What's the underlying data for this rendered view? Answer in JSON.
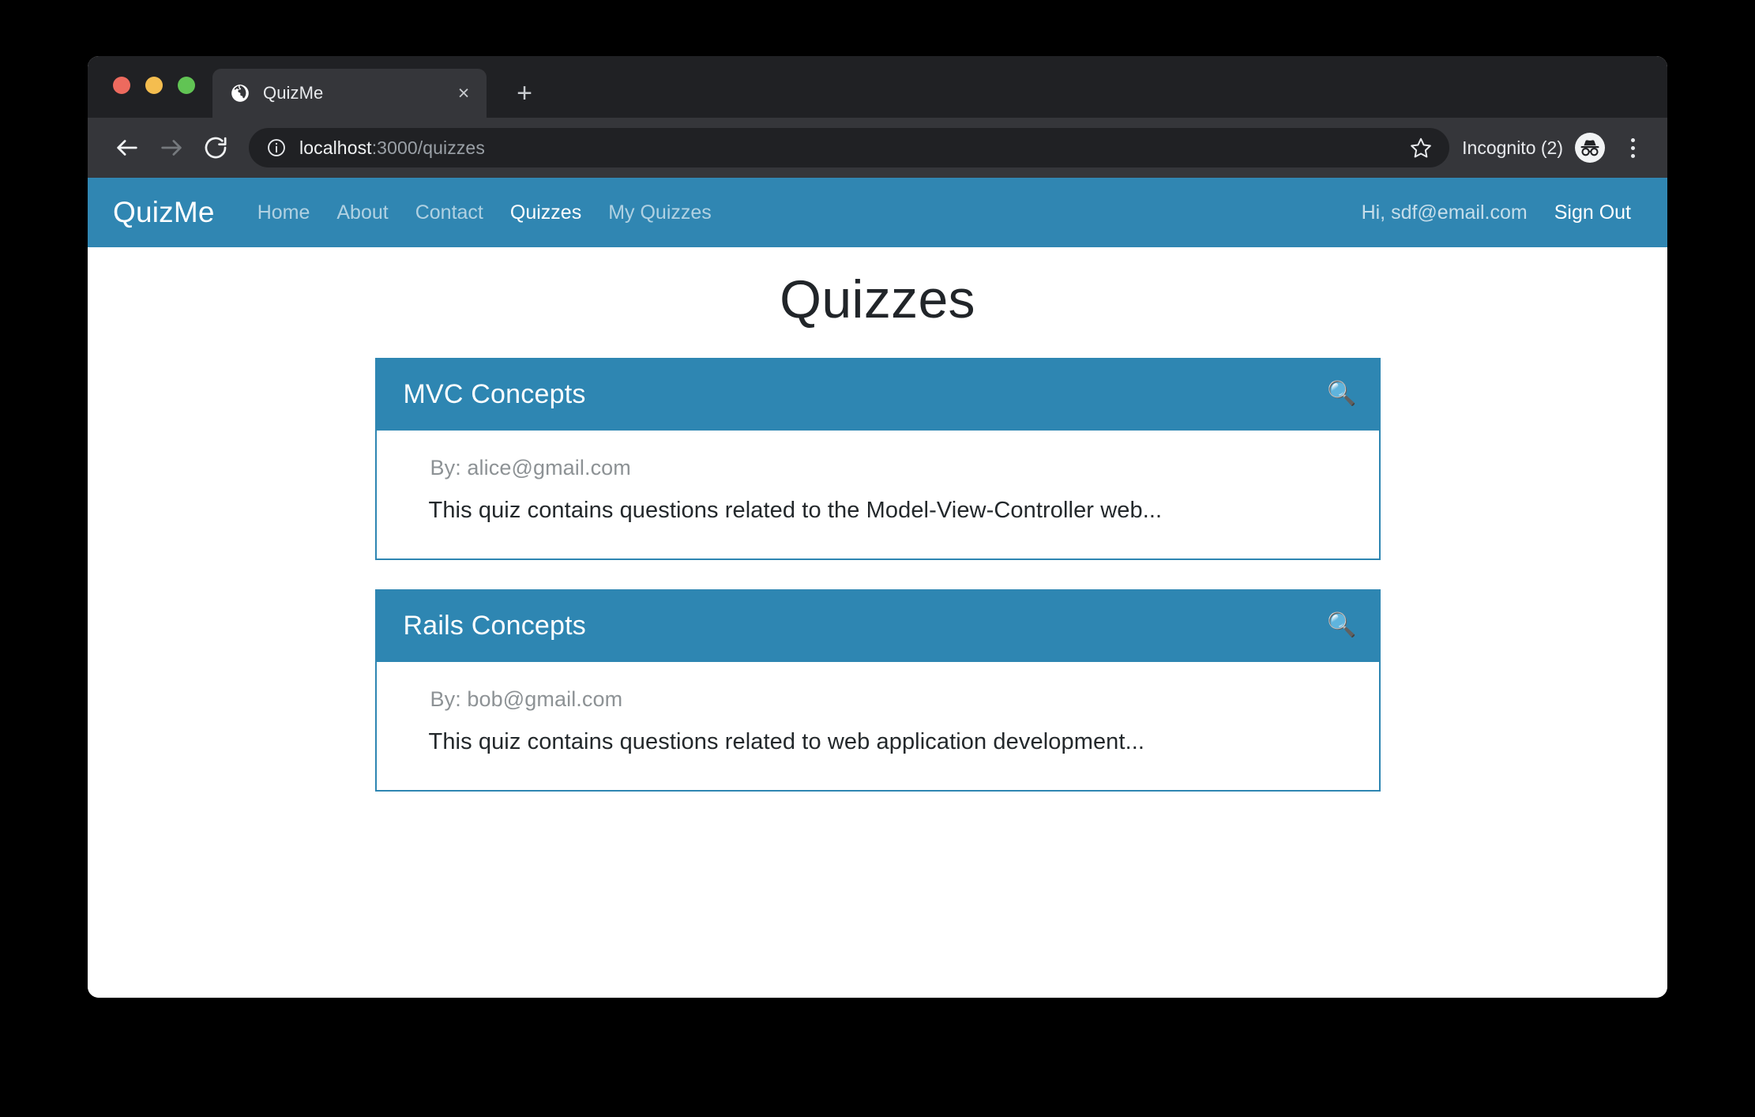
{
  "browser": {
    "tab": {
      "title": "QuizMe",
      "favicon": "globe-icon",
      "close_label": "×"
    },
    "new_tab_label": "+",
    "toolbar": {
      "back_label": "back-arrow-icon",
      "forward_label": "forward-arrow-icon",
      "reload_label": "reload-icon",
      "url_host": "localhost",
      "url_path": ":3000/quizzes",
      "url_full": "localhost:3000/quizzes",
      "site_info_icon": "info-circle-icon",
      "bookmark_icon": "star-icon",
      "profile_label": "Incognito (2)",
      "profile_icon": "incognito-icon",
      "menu_icon": "three-dot-menu-icon"
    },
    "window_controls": {
      "close": "close-traffic-light",
      "minimize": "minimize-traffic-light",
      "maximize": "maximize-traffic-light"
    }
  },
  "colors": {
    "brand_blue": "#3086B2",
    "card_header_blue": "#2E86B2",
    "tab_strip": "#202124",
    "toolbar": "#35363A",
    "page_bg": "#FFFFFF",
    "traffic_red": "#ED6A5E",
    "traffic_yellow": "#F4BD4F",
    "traffic_green": "#61C454"
  },
  "navbar": {
    "brand": "QuizMe",
    "links": [
      {
        "label": "Home",
        "active": false
      },
      {
        "label": "About",
        "active": false
      },
      {
        "label": "Contact",
        "active": false
      },
      {
        "label": "Quizzes",
        "active": true
      },
      {
        "label": "My Quizzes",
        "active": false
      }
    ],
    "greeting": "Hi, sdf@email.com",
    "sign_out": "Sign Out"
  },
  "page": {
    "title": "Quizzes",
    "quizzes": [
      {
        "title": "MVC Concepts",
        "author": "By: alice@gmail.com",
        "description": "This quiz contains questions related to the Model-View-Controller web...",
        "icon": "magnifying-glass-icon",
        "icon_glyph": "🔍"
      },
      {
        "title": "Rails Concepts",
        "author": "By: bob@gmail.com",
        "description": "This quiz contains questions related to web application development...",
        "icon": "magnifying-glass-icon",
        "icon_glyph": "🔍"
      }
    ]
  }
}
